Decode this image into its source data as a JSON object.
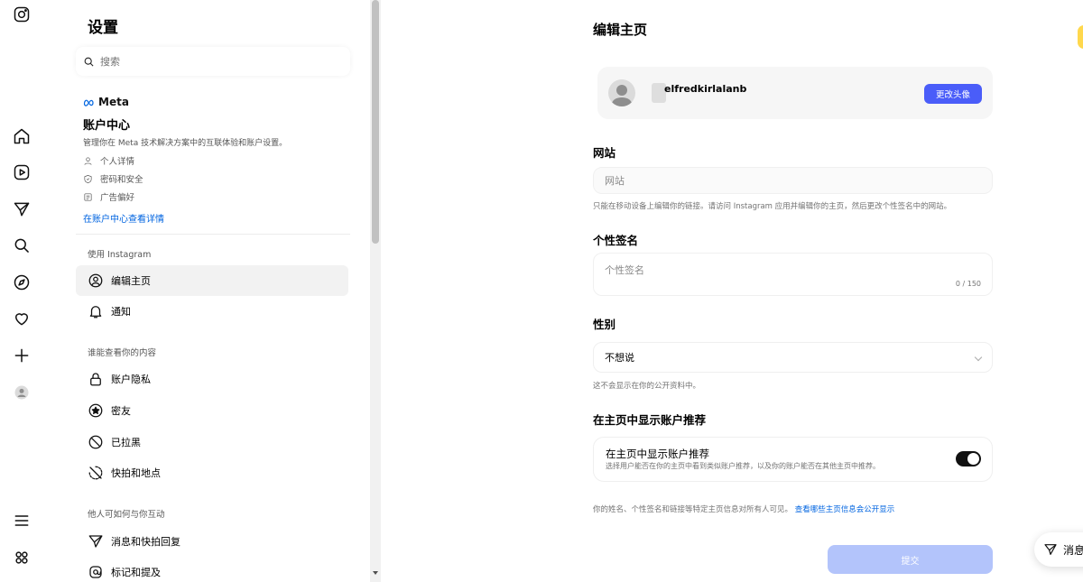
{
  "sidebar": {
    "title": "设置",
    "search_placeholder": "搜索",
    "accounts_center": {
      "brand": "Meta",
      "title": "账户中心",
      "description": "管理你在 Meta 技术解决方案中的互联体验和账户设置。",
      "items": [
        {
          "label": "个人详情",
          "icon": "person-icon"
        },
        {
          "label": "密码和安全",
          "icon": "shield-icon"
        },
        {
          "label": "广告偏好",
          "icon": "ads-icon"
        }
      ],
      "link": "在账户中心查看详情"
    },
    "section_usage": "使用 Instagram",
    "usage_items": [
      {
        "label": "编辑主页",
        "icon": "user-circle-icon",
        "active": true
      },
      {
        "label": "通知",
        "icon": "bell-icon"
      }
    ],
    "section_visibility": "谁能查看你的内容",
    "visibility_items": [
      {
        "label": "账户隐私",
        "icon": "lock-icon"
      },
      {
        "label": "密友",
        "icon": "star-circle-icon"
      },
      {
        "label": "已拉黑",
        "icon": "block-icon"
      },
      {
        "label": "快拍和地点",
        "icon": "story-off-icon"
      }
    ],
    "section_interaction": "他人可如何与你互动",
    "interaction_items": [
      {
        "label": "消息和快拍回复",
        "icon": "send-icon"
      },
      {
        "label": "标记和提及",
        "icon": "at-icon"
      }
    ]
  },
  "main": {
    "title": "编辑主页",
    "profile": {
      "username": "elfredkirlalanb",
      "change_photo_label": "更改头像"
    },
    "website": {
      "label": "网站",
      "placeholder": "网站",
      "help": "只能在移动设备上编辑你的链接。请访问 Instagram 应用并编辑你的主页，然后更改个性签名中的网站。"
    },
    "bio": {
      "label": "个性签名",
      "placeholder": "个性签名",
      "counter": "0 / 150"
    },
    "gender": {
      "label": "性别",
      "value": "不想说",
      "help": "这不会显示在你的公开资料中。"
    },
    "suggestions": {
      "label": "在主页中显示账户推荐",
      "toggle_title": "在主页中显示账户推荐",
      "toggle_desc": "选择用户能否在你的主页中看到类似账户推荐，以及你的账户能否在其他主页中推荐。",
      "enabled": true
    },
    "footnote_text": "你的姓名、个性签名和链接等特定主页信息对所有人可见。",
    "footnote_link": "查看哪些主页信息会公开显示",
    "submit_label": "提交"
  },
  "messages_label": "消息"
}
